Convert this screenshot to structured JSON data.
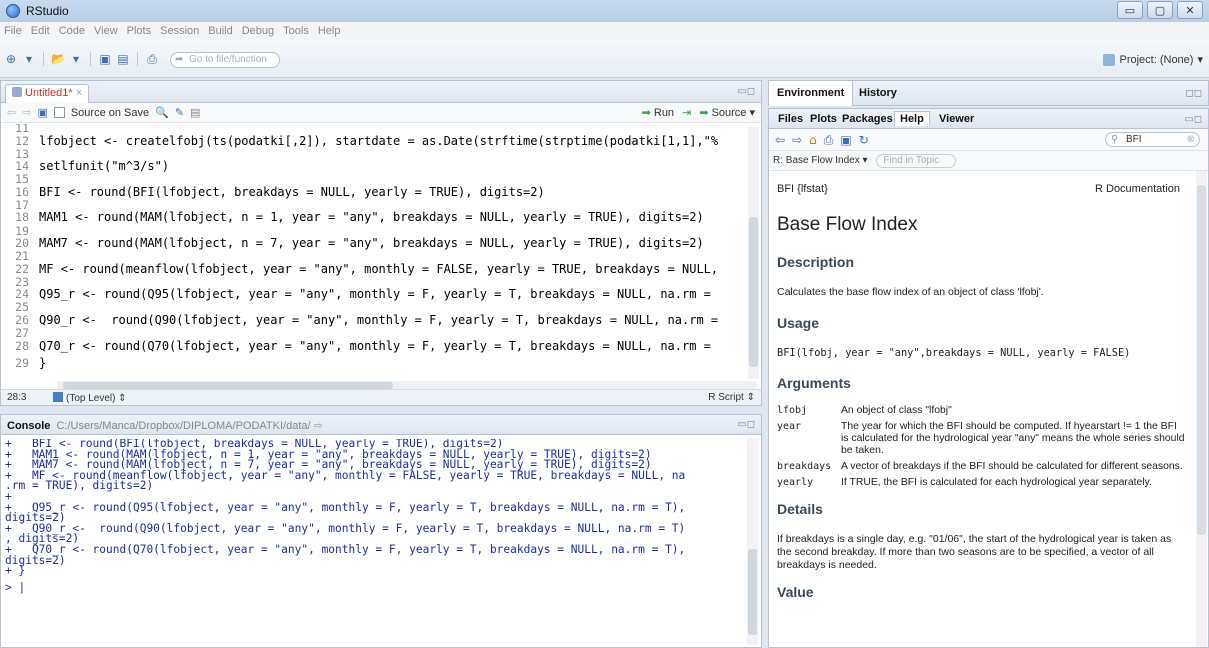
{
  "window": {
    "title": "RStudio",
    "controls": [
      "▭",
      "▢",
      "✕"
    ]
  },
  "menu": [
    "File",
    "Edit",
    "Code",
    "View",
    "Plots",
    "Session",
    "Build",
    "Debug",
    "Tools",
    "Help"
  ],
  "toolbar": {
    "goto_placeholder": "Go to file/function",
    "project_label": "Project: (None)"
  },
  "editor": {
    "tab_label": "Untitled1*",
    "source_on_save": "Source on Save",
    "run_label": "Run",
    "source_label": "Source",
    "cursor_pos": "28:3",
    "scope": "(Top Level)",
    "file_type": "R Script",
    "lines": [
      {
        "n": "11",
        "t": ""
      },
      {
        "n": "12",
        "t": "lfobject <- createlfobj(ts(podatki[,2]), startdate = as.Date(strftime(strptime(podatki[1,1],\"%"
      },
      {
        "n": "13",
        "t": ""
      },
      {
        "n": "14",
        "t": "setlfunit(\"m^3/s\")"
      },
      {
        "n": "15",
        "t": ""
      },
      {
        "n": "16",
        "t": "BFI <- round(BFI(lfobject, breakdays = NULL, yearly = TRUE), digits=2)"
      },
      {
        "n": "17",
        "t": ""
      },
      {
        "n": "18",
        "t": "MAM1 <- round(MAM(lfobject, n = 1, year = \"any\", breakdays = NULL, yearly = TRUE), digits=2)"
      },
      {
        "n": "19",
        "t": ""
      },
      {
        "n": "20",
        "t": "MAM7 <- round(MAM(lfobject, n = 7, year = \"any\", breakdays = NULL, yearly = TRUE), digits=2)"
      },
      {
        "n": "21",
        "t": ""
      },
      {
        "n": "22",
        "t": "MF <- round(meanflow(lfobject, year = \"any\", monthly = FALSE, yearly = TRUE, breakdays = NULL,"
      },
      {
        "n": "23",
        "t": ""
      },
      {
        "n": "24",
        "t": "Q95_r <- round(Q95(lfobject, year = \"any\", monthly = F, yearly = T, breakdays = NULL, na.rm ="
      },
      {
        "n": "25",
        "t": ""
      },
      {
        "n": "26",
        "t": "Q90_r <-  round(Q90(lfobject, year = \"any\", monthly = F, yearly = T, breakdays = NULL, na.rm ="
      },
      {
        "n": "27",
        "t": ""
      },
      {
        "n": "28",
        "t": "Q70_r <- round(Q70(lfobject, year = \"any\", monthly = F, yearly = T, breakdays = NULL, na.rm ="
      },
      {
        "n": "29",
        "t": "}"
      }
    ]
  },
  "console": {
    "title": "Console",
    "path": "C:/Users/Manca/Dropbox/DIPLOMA/PODATKI/data/",
    "lines": [
      "+   BFI <- round(BFI(lfobject, breakdays = NULL, yearly = TRUE), digits=2)",
      "+   MAM1 <- round(MAM(lfobject, n = 1, year = \"any\", breakdays = NULL, yearly = TRUE), digits=2)",
      "+   MAM7 <- round(MAM(lfobject, n = 7, year = \"any\", breakdays = NULL, yearly = TRUE), digits=2)",
      "+   MF <- round(meanflow(lfobject, year = \"any\", monthly = FALSE, yearly = TRUE, breakdays = NULL, na",
      ".rm = TRUE), digits=2)",
      "+",
      "+   Q95_r <- round(Q95(lfobject, year = \"any\", monthly = F, yearly = T, breakdays = NULL, na.rm = T),",
      "digits=2)",
      "+   Q90_r <-  round(Q90(lfobject, year = \"any\", monthly = F, yearly = T, breakdays = NULL, na.rm = T)",
      ", digits=2)",
      "+   Q70_r <- round(Q70(lfobject, year = \"any\", monthly = F, yearly = T, breakdays = NULL, na.rm = T),",
      "digits=2)",
      "+ }"
    ],
    "prompt": "> |"
  },
  "env_tabs": [
    "Environment",
    "History"
  ],
  "help_tabs": [
    "Files",
    "Plots",
    "Packages",
    "Help",
    "Viewer"
  ],
  "help": {
    "search_value": "BFI",
    "topic_select": "R: Base Flow Index",
    "find_in_topic": "Find in Topic",
    "pkg": "BFI {lfstat}",
    "rdoc": "R Documentation",
    "title": "Base Flow Index",
    "description_h": "Description",
    "description": "Calculates the base flow index of an object of class 'lfobj'.",
    "usage_h": "Usage",
    "usage": "BFI(lfobj, year = \"any\",breakdays = NULL, yearly = FALSE)",
    "arguments_h": "Arguments",
    "args": [
      {
        "name": "lfobj",
        "desc": "An object of class \"lfobj\""
      },
      {
        "name": "year",
        "desc": "The year for which the BFI should be computed. If hyearstart != 1 the BFI is calculated for the hydrological year \"any\" means the whole series should be taken."
      },
      {
        "name": "breakdays",
        "desc": "A vector of breakdays if the BFI should be calculated for different seasons."
      },
      {
        "name": "yearly",
        "desc": "If TRUE, the BFI is calculated for each hydrological year separately."
      }
    ],
    "details_h": "Details",
    "details": "If breakdays is a single day, e.g. \"01/06\", the start of the hydrological year is taken as the second breakday. If more than two seasons are to be specified, a vector of all breakdays is needed.",
    "value_h": "Value"
  }
}
